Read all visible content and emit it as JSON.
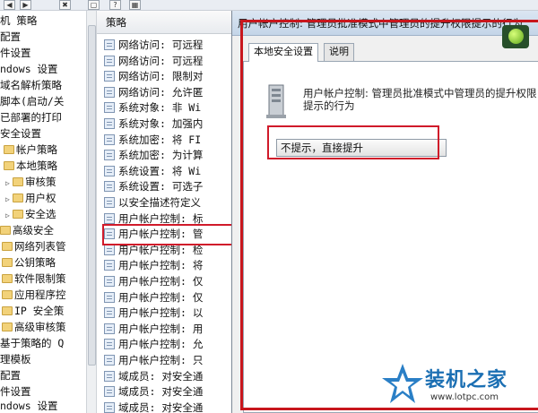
{
  "toolbar": {
    "buttons": [
      "◀",
      "▶",
      "✖",
      "▢",
      "?",
      "▦"
    ]
  },
  "tree": {
    "items": [
      "机 策略",
      "配置",
      "件设置",
      "ndows 设置",
      "域名解析策略",
      "脚本(启动/关",
      "已部署的打印",
      "安全设置",
      "帐户策略",
      "本地策略",
      "审核策",
      "用户权",
      "安全选",
      "高级安全",
      "网络列表管",
      "公钥策略",
      "软件限制策",
      "应用程序控",
      "IP 安全策",
      "高级审核策",
      "基于策略的 Q",
      "理模板",
      "配置",
      "件设置",
      "ndows 设置"
    ]
  },
  "list": {
    "header": "策略",
    "rows": [
      "网络访问: 可远程",
      "网络访问: 可远程",
      "网络访问: 限制对",
      "网络访问: 允许匿",
      "系统对象: 非 Wi",
      "系统对象: 加强内",
      "系统加密: 将 FI",
      "系统加密: 为计算",
      "系统设置: 将 Wi",
      "系统设置: 可选子",
      "以安全描述符定义",
      "用户帐户控制: 标",
      "用户帐户控制: 管",
      "用户帐户控制: 检",
      "用户帐户控制: 将",
      "用户帐户控制: 仅",
      "用户帐户控制: 仅",
      "用户帐户控制: 以",
      "用户帐户控制: 用",
      "用户帐户控制: 允",
      "用户帐户控制: 只",
      "域成员: 对安全通",
      "域成员: 对安全通",
      "域成员: 对安全通"
    ]
  },
  "dialog": {
    "title": "用户帐户控制: 管理员批准模式中管理员的提升权限提示的行为",
    "tabs": [
      "本地安全设置",
      "说明"
    ],
    "description": "用户帐户控制: 管理员批准模式中管理员的提升权限提示的行为",
    "combo_value": "不提示，直接提升"
  },
  "watermark": {
    "title": "装机之家",
    "url": "www.lotpc.com"
  }
}
